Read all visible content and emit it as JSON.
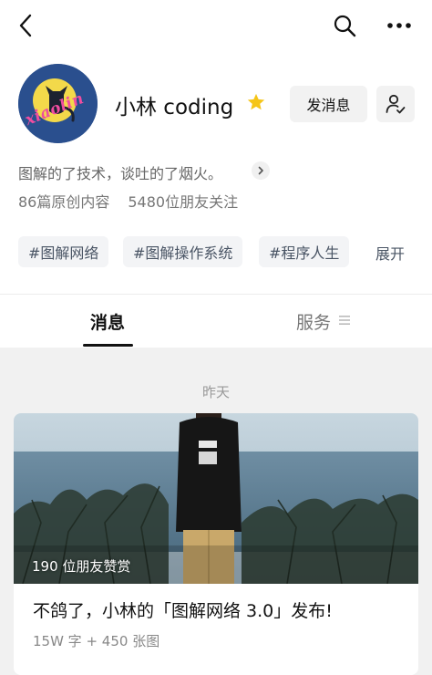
{
  "topbar": {
    "back_icon": "chevron-left-icon",
    "search_icon": "search-icon",
    "more_icon": "more-dots-icon"
  },
  "profile": {
    "avatar_text": "xiaolin",
    "name": "小林 coding",
    "star_color": "#f5c518",
    "message_button": "发消息",
    "bio": "图解的了技术，谈吐的了烟火。",
    "original_count": "86篇原创内容",
    "followers": "5480位朋友关注"
  },
  "tags": [
    "#图解网络",
    "#图解操作系统",
    "#程序人生"
  ],
  "tags_expand": "展开",
  "tabs": {
    "messages": "消息",
    "services": "服务"
  },
  "feed": {
    "date": "昨天",
    "card": {
      "likes": "190 位朋友赞赏",
      "title": "不鸽了，小林的「图解网络 3.0」发布!",
      "meta": "15W 字 + 450 张图"
    }
  },
  "colors": {
    "accent": "#111111",
    "tag_bg": "#f3f4f6",
    "feed_bg": "#f1f1f1",
    "avatar_bg": "#2a4f8e",
    "avatar_moon": "#f3d94a"
  }
}
